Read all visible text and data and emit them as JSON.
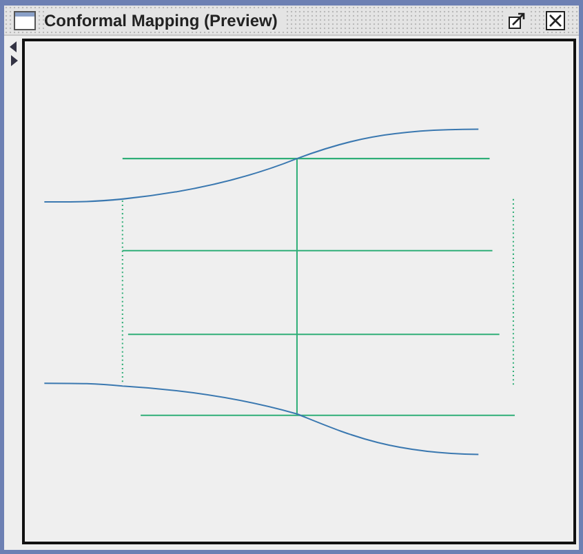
{
  "window": {
    "title": "Conformal Mapping (Preview)"
  }
}
